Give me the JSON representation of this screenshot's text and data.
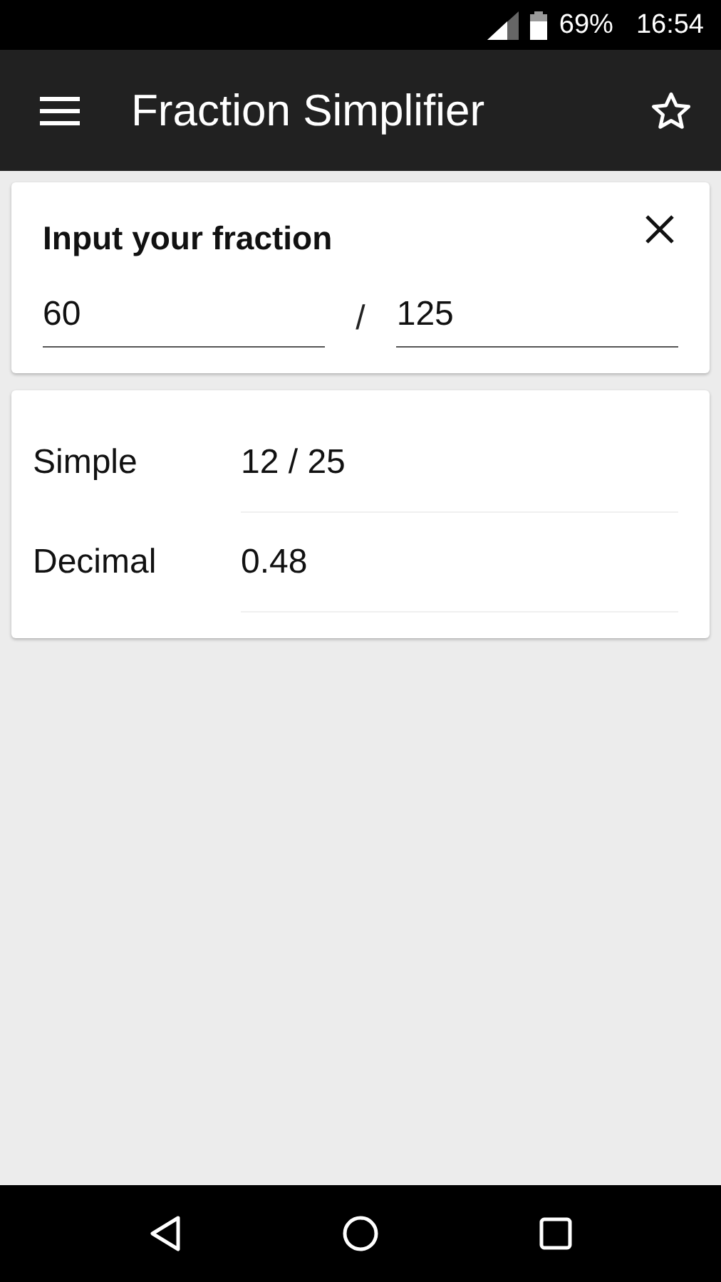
{
  "status_bar": {
    "battery": "69%",
    "time": "16:54"
  },
  "app_bar": {
    "title": "Fraction Simplifier"
  },
  "input_card": {
    "title": "Input your fraction",
    "numerator": "60",
    "separator": "/",
    "denominator": "125"
  },
  "results": [
    {
      "label": "Simple",
      "value": "12 / 25"
    },
    {
      "label": "Decimal",
      "value": "0.48"
    }
  ]
}
